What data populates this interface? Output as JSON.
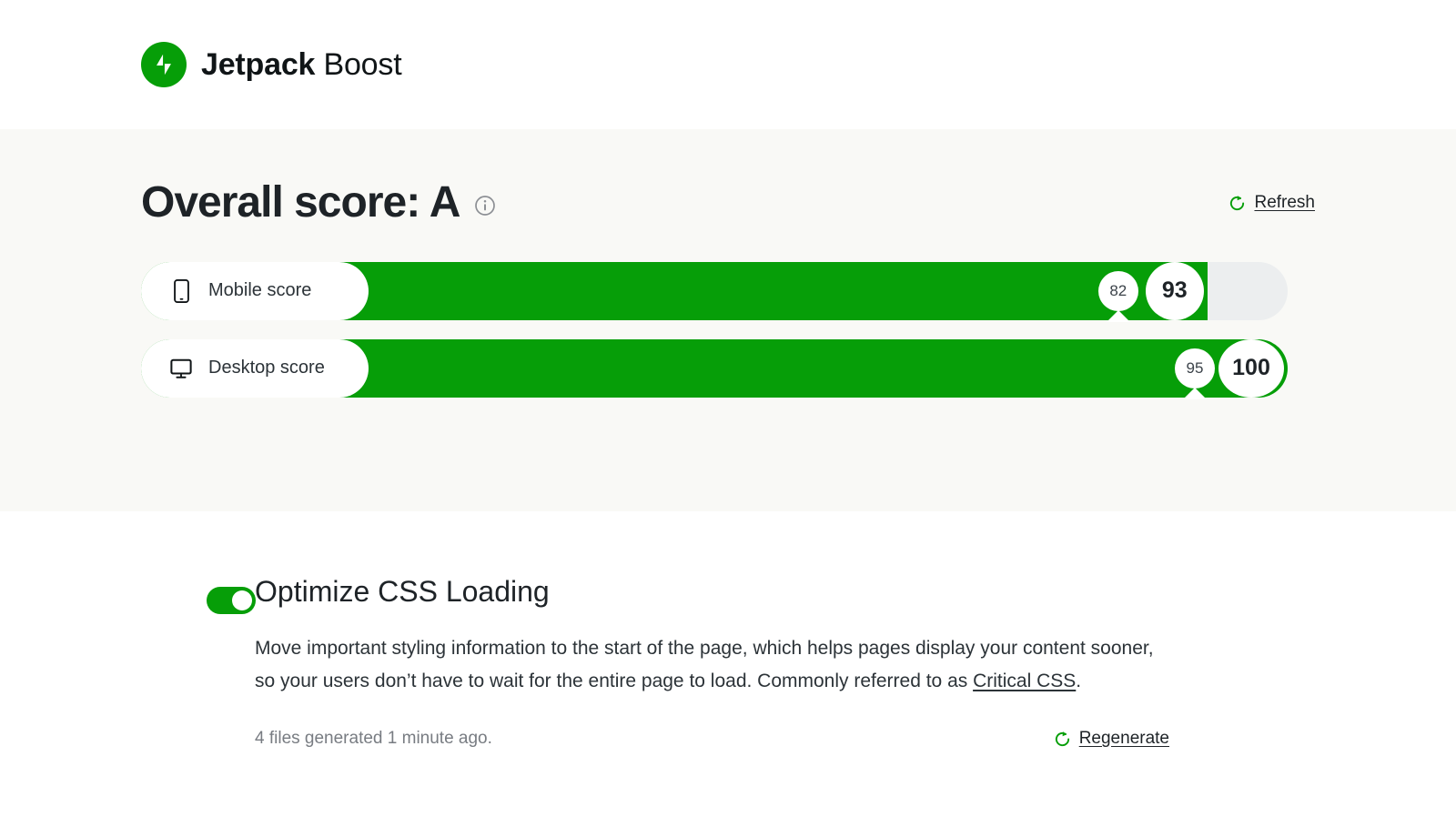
{
  "header": {
    "logo_icon": "jetpack-bolt-icon",
    "brand_strong": "Jetpack",
    "brand_light": "Boost",
    "brand_color": "#069e08"
  },
  "score_panel": {
    "background": "#f9f9f6",
    "title": "Overall score: A",
    "info_icon": "info-circle-icon",
    "refresh": {
      "icon": "refresh-icon",
      "label": "Refresh"
    },
    "bar_color": "#069e08",
    "track_color": "#eceeef",
    "rows": [
      {
        "icon": "mobile-phone-icon",
        "label": "Mobile score",
        "current": "93",
        "previous": "82",
        "fill_percent": 93
      },
      {
        "icon": "desktop-monitor-icon",
        "label": "Desktop score",
        "current": "100",
        "previous": "95",
        "fill_percent": 100
      }
    ]
  },
  "module": {
    "toggle_state": "on",
    "toggle_color": "#069e08",
    "title": "Optimize CSS Loading",
    "description_before": "Move important styling information to the start of the page, which helps pages display your content sooner, so your users don’t have to wait for the entire page to load. Commonly referred to as ",
    "description_link": "Critical CSS",
    "description_after": ".",
    "status": "4 files generated 1 minute ago.",
    "regenerate": {
      "icon": "refresh-icon",
      "label": "Regenerate"
    }
  }
}
